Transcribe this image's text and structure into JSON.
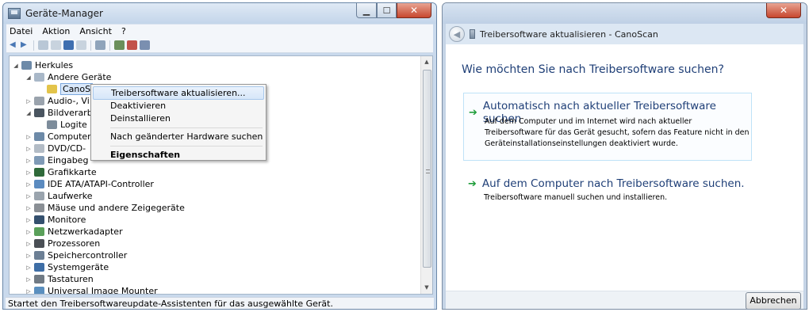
{
  "device_manager": {
    "title": "Geräte-Manager",
    "menu": [
      "Datei",
      "Aktion",
      "Ansicht",
      "?"
    ],
    "tree": [
      {
        "label": "Herkules",
        "level": 0,
        "expander": "expanded",
        "icon": "computer-icon"
      },
      {
        "label": "Andere Geräte",
        "level": 1,
        "expander": "expanded",
        "icon": "unknown-devices-icon"
      },
      {
        "label": "CanoS",
        "level": 2,
        "expander": "",
        "icon": "warning-device-icon",
        "selected": true
      },
      {
        "label": "Audio-, Vi",
        "level": 1,
        "expander": "collapsed",
        "icon": "speaker-icon"
      },
      {
        "label": "Bildverarb",
        "level": 1,
        "expander": "expanded",
        "icon": "camera-icon"
      },
      {
        "label": "Logite",
        "level": 2,
        "expander": "",
        "icon": "webcam-icon"
      },
      {
        "label": "Computer",
        "level": 1,
        "expander": "collapsed",
        "icon": "computer-icon"
      },
      {
        "label": "DVD/CD-",
        "level": 1,
        "expander": "collapsed",
        "icon": "disc-drive-icon"
      },
      {
        "label": "Eingabeg",
        "level": 1,
        "expander": "collapsed",
        "icon": "input-device-icon"
      },
      {
        "label": "Grafikkarte",
        "level": 1,
        "expander": "collapsed",
        "icon": "display-adapter-icon"
      },
      {
        "label": "IDE ATA/ATAPI-Controller",
        "level": 1,
        "expander": "collapsed",
        "icon": "ide-controller-icon"
      },
      {
        "label": "Laufwerke",
        "level": 1,
        "expander": "collapsed",
        "icon": "disk-drive-icon"
      },
      {
        "label": "Mäuse und andere Zeigegeräte",
        "level": 1,
        "expander": "collapsed",
        "icon": "mouse-icon"
      },
      {
        "label": "Monitore",
        "level": 1,
        "expander": "collapsed",
        "icon": "monitor-icon"
      },
      {
        "label": "Netzwerkadapter",
        "level": 1,
        "expander": "collapsed",
        "icon": "network-adapter-icon"
      },
      {
        "label": "Prozessoren",
        "level": 1,
        "expander": "collapsed",
        "icon": "processor-icon"
      },
      {
        "label": "Speichercontroller",
        "level": 1,
        "expander": "collapsed",
        "icon": "storage-controller-icon"
      },
      {
        "label": "Systemgeräte",
        "level": 1,
        "expander": "collapsed",
        "icon": "system-devices-icon"
      },
      {
        "label": "Tastaturen",
        "level": 1,
        "expander": "collapsed",
        "icon": "keyboard-icon"
      },
      {
        "label": "Universal Image Mounter",
        "level": 1,
        "expander": "collapsed",
        "icon": "image-mounter-icon"
      }
    ],
    "context_menu": [
      {
        "label": "Treibersoftware aktualisieren...",
        "highlighted": true
      },
      {
        "label": "Deaktivieren"
      },
      {
        "label": "Deinstallieren"
      },
      {
        "separator": true
      },
      {
        "label": "Nach geänderter Hardware suchen"
      },
      {
        "separator": true
      },
      {
        "label": "Eigenschaften",
        "bold": true
      }
    ],
    "status": "Startet den Treibersoftwareupdate-Assistenten für das ausgewählte Gerät."
  },
  "wizard": {
    "title": "Treibersoftware aktualisieren - CanoScan",
    "question": "Wie möchten Sie nach Treibersoftware suchen?",
    "option1": {
      "title": "Automatisch nach aktueller Treibersoftware suchen",
      "description": "Auf dem Computer und im Internet wird nach aktueller Treibersoftware für das Gerät gesucht, sofern das Feature nicht in den Geräteinstallationseinstellungen deaktiviert wurde."
    },
    "option2": {
      "title": "Auf dem Computer nach Treibersoftware suchen.",
      "description": "Treibersoftware manuell suchen und installieren."
    },
    "cancel_label": "Abbrechen"
  },
  "colors": {
    "accent_link": "#1f3f77",
    "arrow_green": "#1f9d3a",
    "selection": "#d9e8fa"
  }
}
